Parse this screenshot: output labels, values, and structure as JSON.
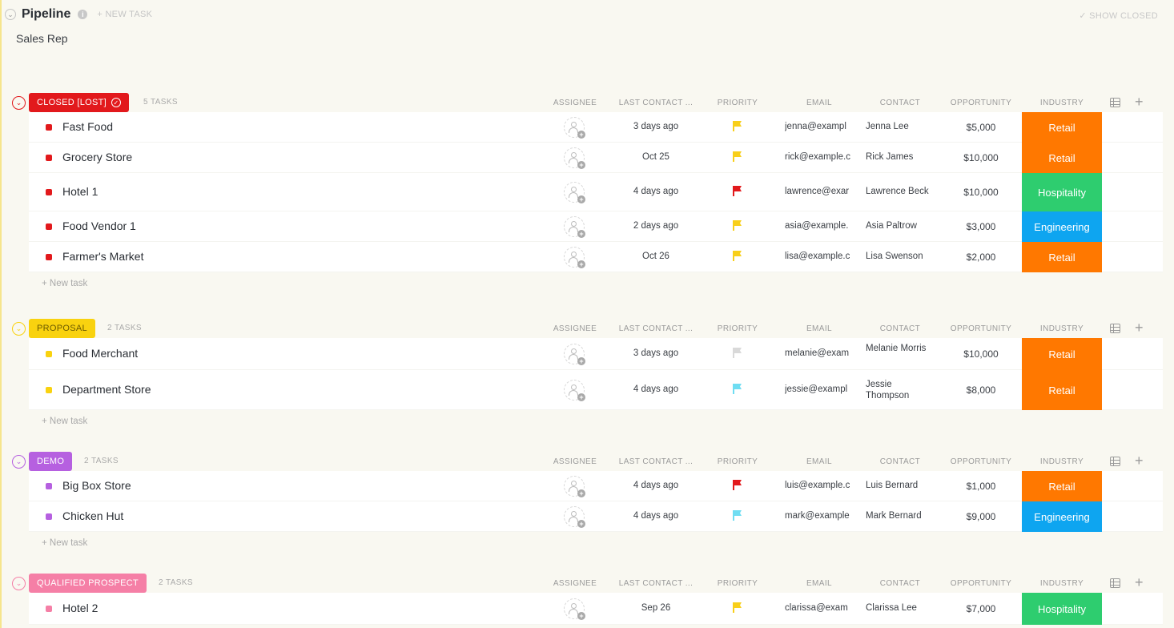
{
  "header": {
    "title": "Pipeline",
    "new_task_label": "+ NEW TASK",
    "show_closed_label": "✓ SHOW CLOSED",
    "subtitle": "Sales Rep"
  },
  "columns": {
    "assignee": "ASSIGNEE",
    "last_contact": "LAST CONTACT ...",
    "priority": "PRIORITY",
    "email": "EMAIL",
    "contact": "CONTACT",
    "opportunity": "OPPORTUNITY",
    "industry": "INDUSTRY"
  },
  "colors": {
    "retail": "#ff7800",
    "hospitality": "#2ecd6f",
    "engineering": "#0ea5f0",
    "flag_yellow": "#f8cf1a",
    "flag_red": "#e2191c",
    "flag_cyan": "#6fddf2",
    "flag_gray": "#d9d9d9"
  },
  "new_task_row_label": "+ New task",
  "groups": [
    {
      "status": "CLOSED [LOST]",
      "color": "#e2191c",
      "count_label": "5 TASKS",
      "has_check": true,
      "tasks": [
        {
          "name": "Fast Food",
          "last_contact": "3 days ago",
          "priority": "yellow",
          "email": "jenna@exampl",
          "contact": "Jenna Lee",
          "opportunity": "$5,000",
          "industry": "Retail"
        },
        {
          "name": "Grocery Store",
          "last_contact": "Oct 25",
          "priority": "yellow",
          "email": "rick@example.c",
          "contact": "Rick James",
          "opportunity": "$10,000",
          "industry": "Retail"
        },
        {
          "name": "Hotel 1",
          "last_contact": "4 days ago",
          "priority": "red",
          "email": "lawrence@exar",
          "contact": "Lawrence Beck",
          "opportunity": "$10,000",
          "industry": "Hospitality"
        },
        {
          "name": "Food Vendor 1",
          "last_contact": "2 days ago",
          "priority": "yellow",
          "email": "asia@example.",
          "contact": "Asia Paltrow",
          "opportunity": "$3,000",
          "industry": "Engineering"
        },
        {
          "name": "Farmer's Market",
          "last_contact": "Oct 26",
          "priority": "yellow",
          "email": "lisa@example.c",
          "contact": "Lisa Swenson",
          "opportunity": "$2,000",
          "industry": "Retail"
        }
      ]
    },
    {
      "status": "PROPOSAL",
      "color": "#f9d20f",
      "count_label": "2 TASKS",
      "has_check": false,
      "tasks": [
        {
          "name": "Food Merchant",
          "last_contact": "3 days ago",
          "priority": "gray",
          "email": "melanie@exam",
          "contact": "Melanie Morris",
          "opportunity": "$10,000",
          "industry": "Retail"
        },
        {
          "name": "Department Store",
          "last_contact": "4 days ago",
          "priority": "cyan",
          "email": "jessie@exampl",
          "contact": "Jessie Thompson",
          "opportunity": "$8,000",
          "industry": "Retail"
        }
      ]
    },
    {
      "status": "DEMO",
      "color": "#b660e0",
      "count_label": "2 TASKS",
      "has_check": false,
      "tasks": [
        {
          "name": "Big Box Store",
          "last_contact": "4 days ago",
          "priority": "red",
          "email": "luis@example.c",
          "contact": "Luis Bernard",
          "opportunity": "$1,000",
          "industry": "Retail"
        },
        {
          "name": "Chicken Hut",
          "last_contact": "4 days ago",
          "priority": "cyan",
          "email": "mark@example",
          "contact": "Mark Bernard",
          "opportunity": "$9,000",
          "industry": "Engineering"
        }
      ]
    },
    {
      "status": "QUALIFIED PROSPECT",
      "color": "#f57fa6",
      "count_label": "2 TASKS",
      "has_check": false,
      "tasks": [
        {
          "name": "Hotel 2",
          "last_contact": "Sep 26",
          "priority": "yellow",
          "email": "clarissa@exam",
          "contact": "Clarissa Lee",
          "opportunity": "$7,000",
          "industry": "Hospitality"
        }
      ]
    }
  ]
}
